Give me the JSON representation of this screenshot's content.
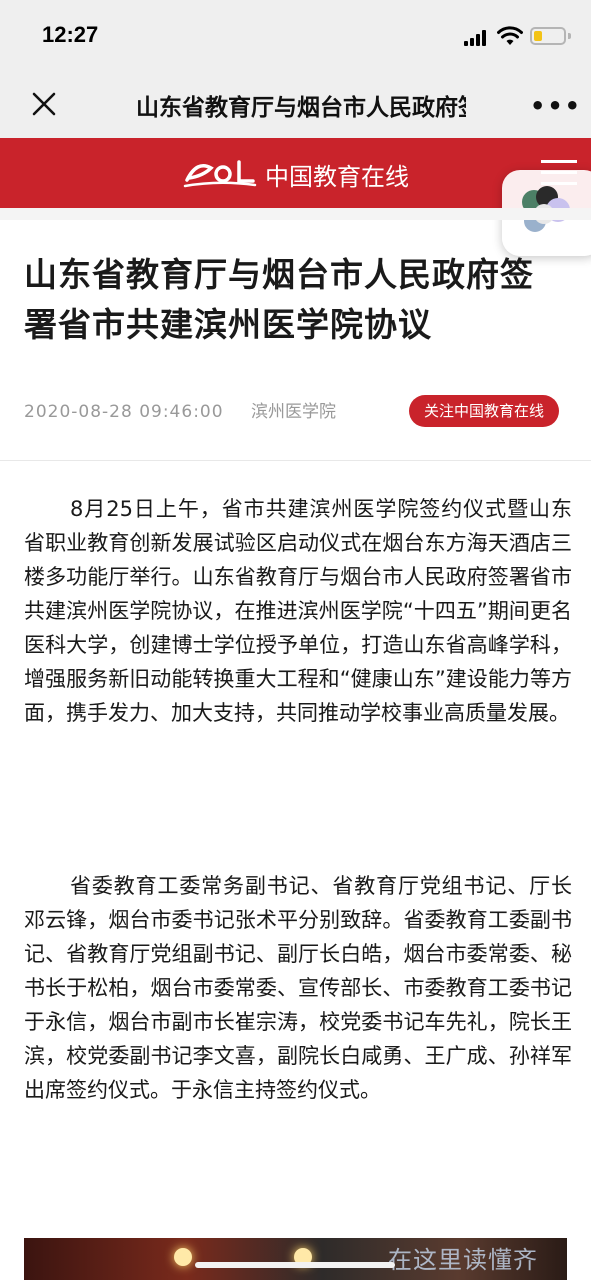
{
  "status_bar": {
    "time": "12:27"
  },
  "nav": {
    "title": "山东省教育厅与烟台市人民政府签署省市共建滨州医学院协议"
  },
  "brand": {
    "logo_text": "eol",
    "name": "中国教育在线",
    "accent_color": "#c9232b"
  },
  "article": {
    "title": "山东省教育厅与烟台市人民政府签署省市共建滨州医学院协议",
    "date": "2020-08-28 09:46:00",
    "source": "滨州医学院",
    "follow_label": "关注中国教育在线",
    "paragraphs": [
      "8月25日上午，省市共建滨州医学院签约仪式暨山东省职业教育创新发展试验区启动仪式在烟台东方海天酒店三楼多功能厅举行。山东省教育厅与烟台市人民政府签署省市共建滨州医学院协议，在推进滨州医学院“十四五”期间更名医科大学，创建博士学位授予单位，打造山东省高峰学科，增强服务新旧动能转换重大工程和“健康山东”建设能力等方面，携手发力、加大支持，共同推动学校事业高质量发展。",
      "省委教育工委常务副书记、省教育厅党组书记、厅长邓云锋，烟台市委书记张术平分别致辞。省委教育工委副书记、省教育厅党组副书记、副厅长白皓，烟台市委常委、秘书长于松柏，烟台市委常委、宣传部长、市委教育工委书记于永信，烟台市副市长崔宗涛，校党委书记车先礼，院长王滨，校党委副书记李文喜，副院长白咸勇、王广成、孙祥军出席签约仪式。于永信主持签约仪式。"
    ]
  },
  "watermark": "在这里读懂齐"
}
